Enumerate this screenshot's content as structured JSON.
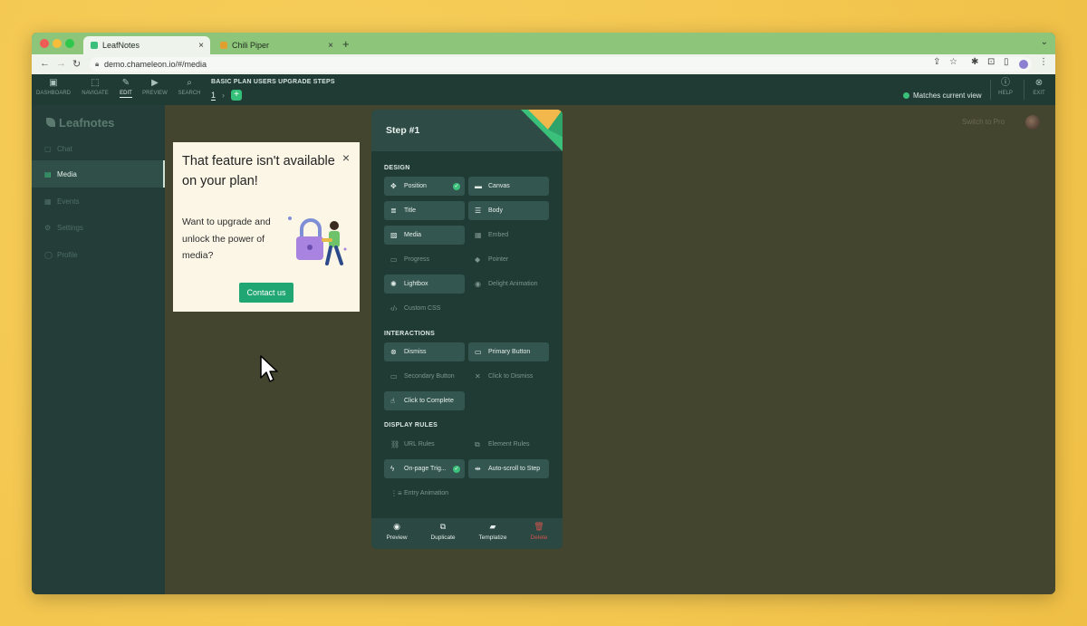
{
  "browser": {
    "tabs": [
      {
        "title": "LeafNotes"
      },
      {
        "title": "Chili Piper"
      }
    ],
    "url": "demo.chameleon.io/#/media"
  },
  "app_toolbar": {
    "tools": [
      {
        "label": "DASHBOARD",
        "icon": "dashboard-icon"
      },
      {
        "label": "NAVIGATE",
        "icon": "navigate-icon"
      },
      {
        "label": "EDIT",
        "icon": "edit-icon"
      },
      {
        "label": "PREVIEW",
        "icon": "preview-icon"
      },
      {
        "label": "SEARCH",
        "icon": "search-icon"
      }
    ],
    "flow_title": "BASIC PLAN USERS UPGRADE STEPS",
    "step_number": "1",
    "matches_text": "Matches current view",
    "help_label": "HELP",
    "exit_label": "EXIT"
  },
  "sidebar": {
    "logo": "Leafnotes",
    "items": [
      {
        "label": "Chat"
      },
      {
        "label": "Media"
      },
      {
        "label": "Events"
      },
      {
        "label": "Settings"
      },
      {
        "label": "Profile"
      }
    ]
  },
  "main": {
    "switch_text": "Switch to Pro"
  },
  "popup": {
    "title": "That feature isn't available on your plan!",
    "body": "Want to upgrade and unlock the power of media?",
    "cta": "Contact us"
  },
  "panel": {
    "title": "Step #1",
    "sections": {
      "design": "DESIGN",
      "interactions": "INTERACTIONS",
      "display_rules": "DISPLAY RULES"
    },
    "design_buttons": [
      {
        "label": "Position",
        "icon": "move-icon"
      },
      {
        "label": "Canvas",
        "icon": "canvas-icon"
      },
      {
        "label": "Title",
        "icon": "title-icon"
      },
      {
        "label": "Body",
        "icon": "body-icon"
      },
      {
        "label": "Media",
        "icon": "image-icon"
      },
      {
        "label": "Embed",
        "icon": "embed-icon"
      },
      {
        "label": "Progress",
        "icon": "progress-icon"
      },
      {
        "label": "Pointer",
        "icon": "pointer-icon"
      },
      {
        "label": "Lightbox",
        "icon": "lightbox-icon"
      },
      {
        "label": "Delight Animation",
        "icon": "animation-icon"
      },
      {
        "label": "Custom CSS",
        "icon": "code-icon"
      }
    ],
    "interaction_buttons": [
      {
        "label": "Dismiss",
        "icon": "dismiss-icon"
      },
      {
        "label": "Primary Button",
        "icon": "primary-button-icon"
      },
      {
        "label": "Secondary Button",
        "icon": "secondary-button-icon"
      },
      {
        "label": "Click to Dismiss",
        "icon": "close-icon"
      },
      {
        "label": "Click to Complete",
        "icon": "click-icon"
      }
    ],
    "rule_buttons": [
      {
        "label": "URL Rules",
        "icon": "link-icon"
      },
      {
        "label": "Element Rules",
        "icon": "element-icon"
      },
      {
        "label": "On-page Trig...",
        "icon": "bolt-icon"
      },
      {
        "label": "Auto-scroll to Step",
        "icon": "scroll-icon"
      },
      {
        "label": "Entry Animation",
        "icon": "entry-icon"
      }
    ],
    "footer": [
      {
        "label": "Preview",
        "icon": "eye-icon"
      },
      {
        "label": "Duplicate",
        "icon": "duplicate-icon"
      },
      {
        "label": "Templatize",
        "icon": "folder-icon"
      },
      {
        "label": "Delete",
        "icon": "trash-icon"
      }
    ]
  }
}
